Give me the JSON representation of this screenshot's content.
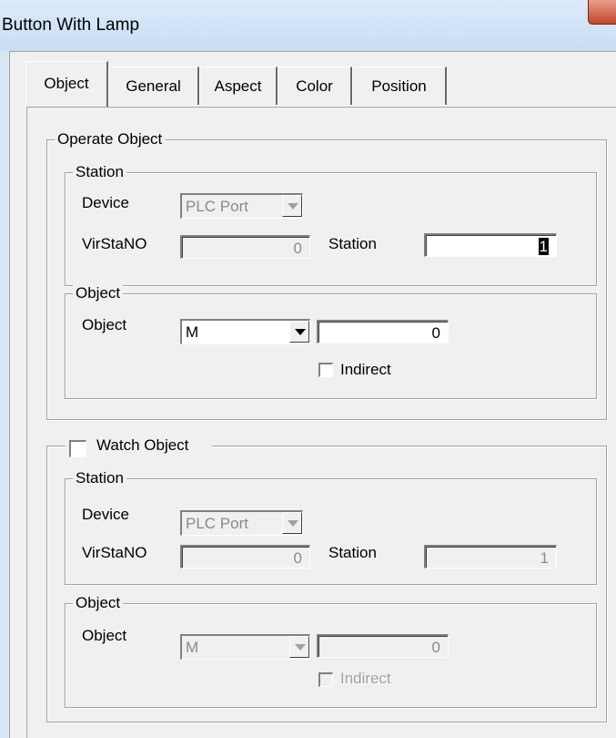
{
  "window": {
    "title": "Button With Lamp"
  },
  "tabs": [
    {
      "label": "Object"
    },
    {
      "label": "General"
    },
    {
      "label": "Aspect"
    },
    {
      "label": "Color"
    },
    {
      "label": "Position"
    }
  ],
  "operate_object": {
    "legend": "Operate Object",
    "station_group": {
      "legend": "Station",
      "device_label": "Device",
      "device_value": "PLC Port",
      "virstano_label": "VirStaNO",
      "virstano_value": "0",
      "station_label": "Station",
      "station_value": "1"
    },
    "object_group": {
      "legend": "Object",
      "object_label": "Object",
      "object_type": "M",
      "object_address": "0",
      "indirect_label": "Indirect",
      "indirect_checked": false
    }
  },
  "watch_object": {
    "legend": "Watch Object",
    "enabled_checked": false,
    "station_group": {
      "legend": "Station",
      "device_label": "Device",
      "device_value": "PLC Port",
      "virstano_label": "VirStaNO",
      "virstano_value": "0",
      "station_label": "Station",
      "station_value": "1"
    },
    "object_group": {
      "legend": "Object",
      "object_label": "Object",
      "object_type": "M",
      "object_address": "0",
      "indirect_label": "Indirect",
      "indirect_checked": false
    }
  },
  "colors": {
    "titlebar": "#d3e4f7",
    "close_button": "#c8533a",
    "dialog_face": "#f0f0f0",
    "disabled_text": "#a0a0a0"
  },
  "icons": {
    "close": "close-icon",
    "dropdown": "chevron-down-icon"
  }
}
